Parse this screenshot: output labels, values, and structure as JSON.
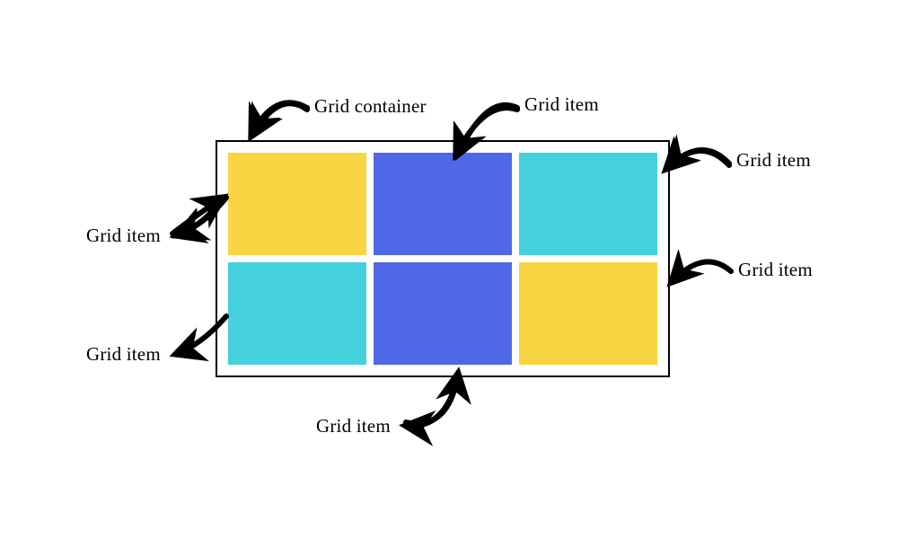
{
  "labels": {
    "container": "Grid container",
    "item_top": "Grid item",
    "item_tr": "Grid item",
    "item_left_1": "Grid item",
    "item_right_mid": "Grid item",
    "item_left_2": "Grid item",
    "item_bottom": "Grid item"
  },
  "colors": {
    "yellow": "#f9d443",
    "blue": "#4e68e8",
    "cyan": "#44d0dc",
    "border": "#000000"
  },
  "grid": {
    "rows": 2,
    "cols": 3,
    "cells": [
      "yellow",
      "blue",
      "cyan",
      "cyan",
      "blue",
      "yellow"
    ]
  }
}
